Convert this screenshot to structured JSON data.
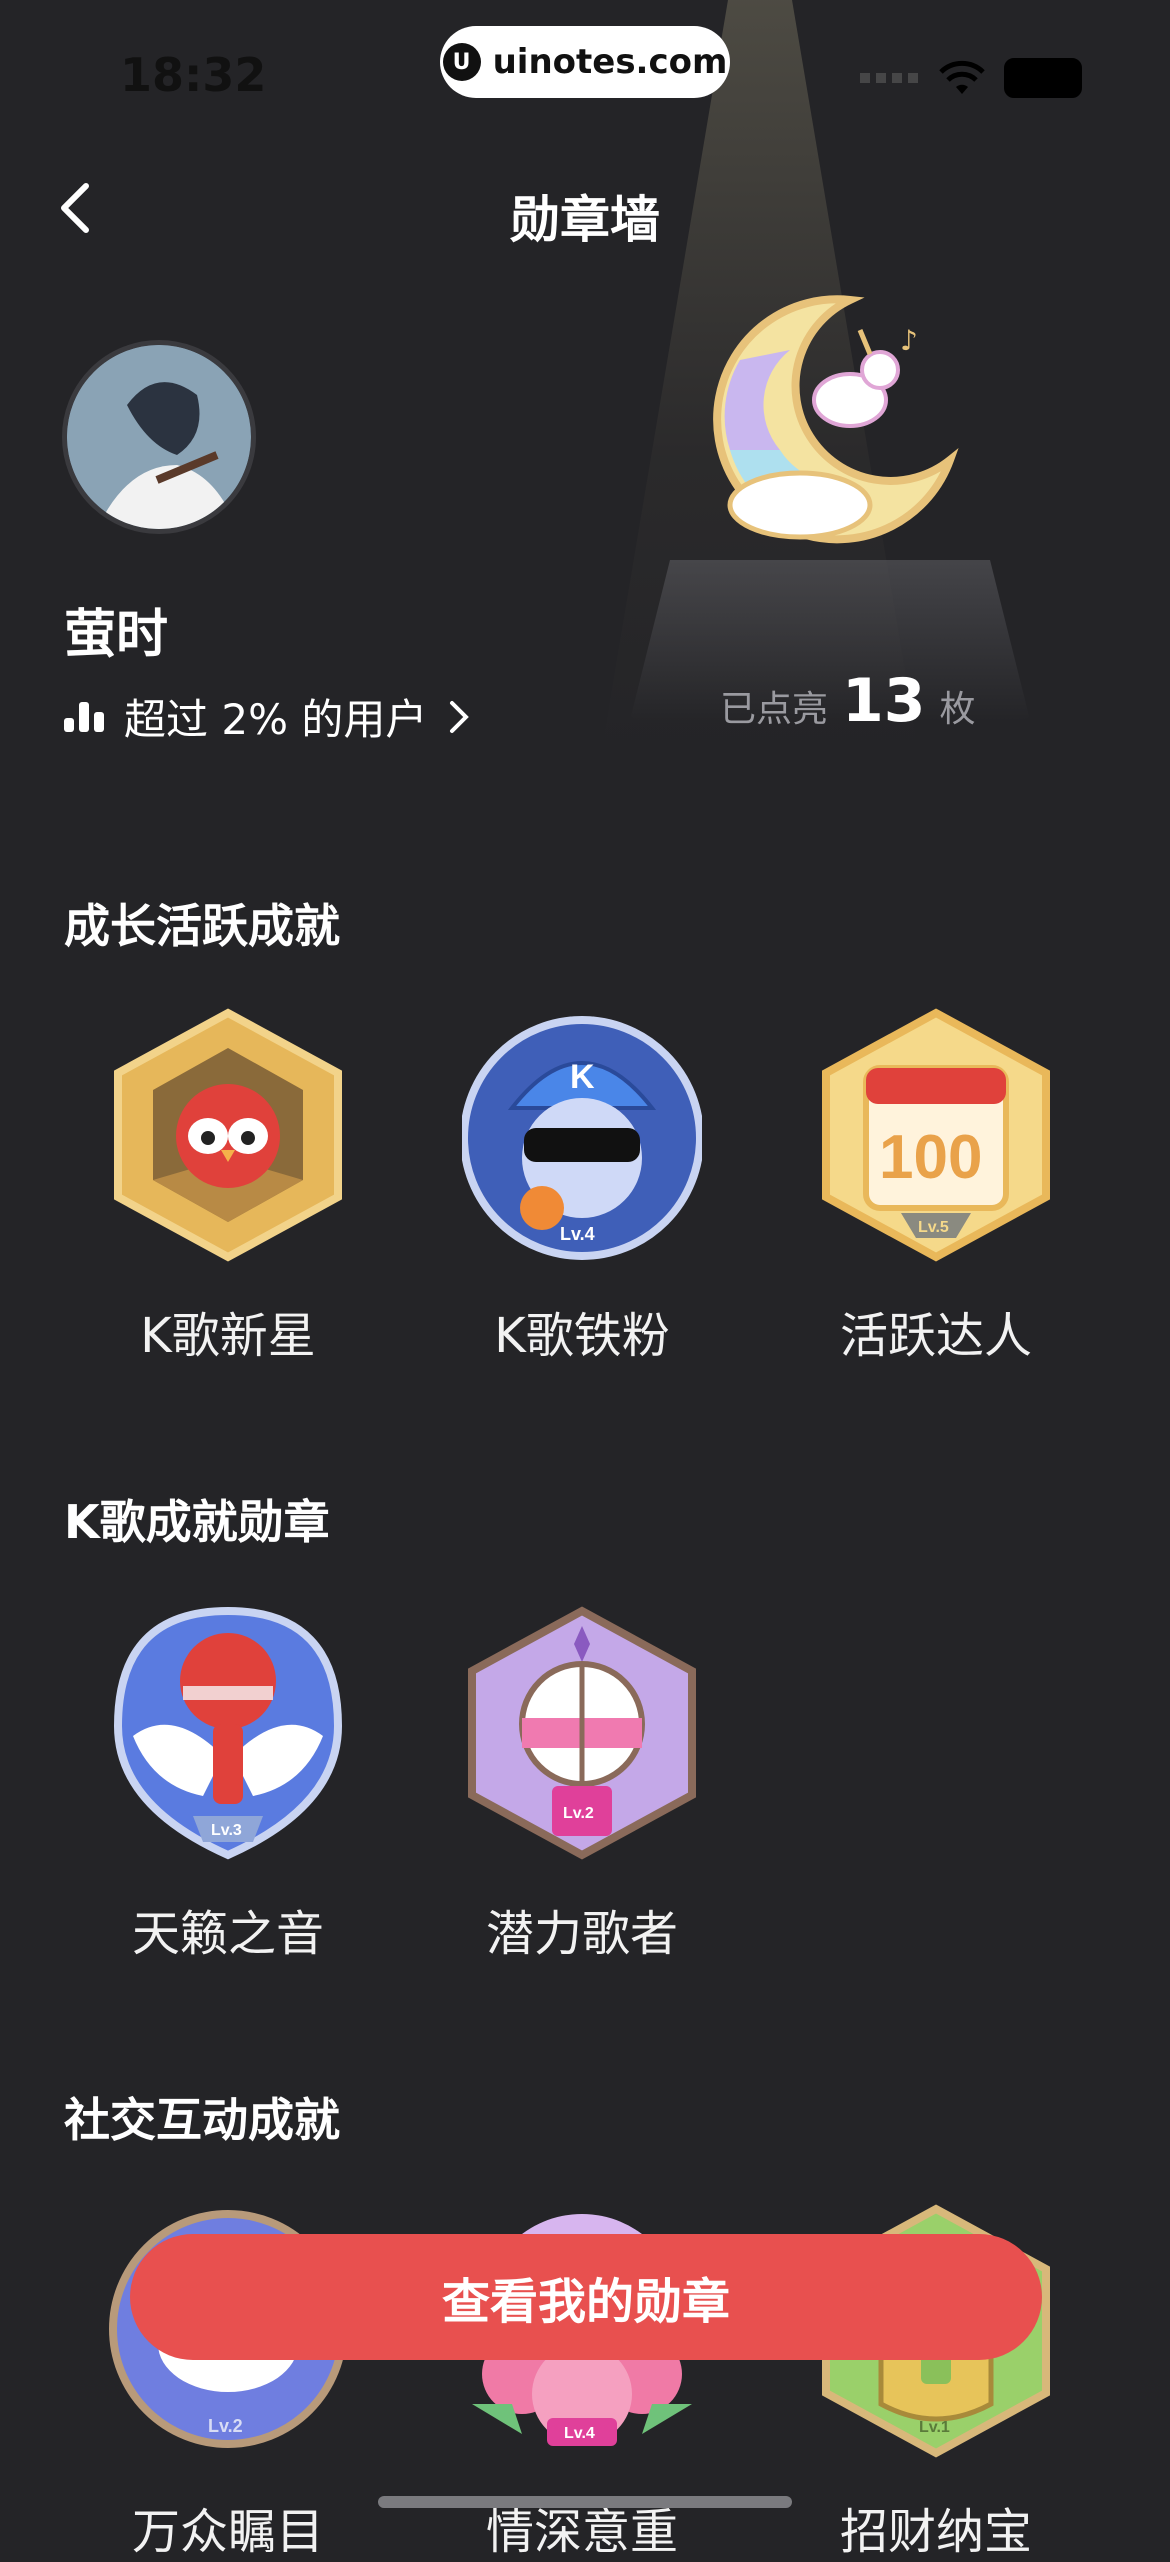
{
  "status_bar": {
    "time": "18:32",
    "url": "uinotes.com"
  },
  "header": {
    "title": "勋章墙"
  },
  "profile": {
    "name": "萤时",
    "rank_text": "超过 2% 的用户",
    "lit_prefix": "已点亮",
    "lit_count": "13",
    "lit_suffix": "枚"
  },
  "sections": [
    {
      "title": "成长活跃成就",
      "badges": [
        {
          "label": "K歌新星",
          "icon": "cardinal-hexagon-badge-icon"
        },
        {
          "label": "K歌铁粉",
          "icon": "sunglasses-singer-badge-icon",
          "level_text": "Lv.4"
        },
        {
          "label": "活跃达人",
          "icon": "calendar-100-badge-icon",
          "number_text": "100",
          "level_text": "Lv.5"
        }
      ]
    },
    {
      "title": "K歌成就勋章",
      "badges": [
        {
          "label": "天籁之音",
          "icon": "winged-microphone-badge-icon",
          "level_text": "Lv.3"
        },
        {
          "label": "潜力歌者",
          "icon": "purple-microphone-badge-icon",
          "level_text": "Lv.2"
        }
      ]
    },
    {
      "title": "社交互动成就",
      "badges": [
        {
          "label": "万众瞩目",
          "icon": "eye-badge-icon",
          "level_text": "Lv.2"
        },
        {
          "label": "情深意重",
          "icon": "rose-badge-icon",
          "level_text": "Lv.4"
        },
        {
          "label": "招财纳宝",
          "icon": "money-bag-badge-icon",
          "level_text": "Lv.1"
        }
      ]
    }
  ],
  "cta": {
    "label": "查看我的勋章"
  },
  "colors": {
    "background": "#242427",
    "cta": "#e8504f"
  }
}
